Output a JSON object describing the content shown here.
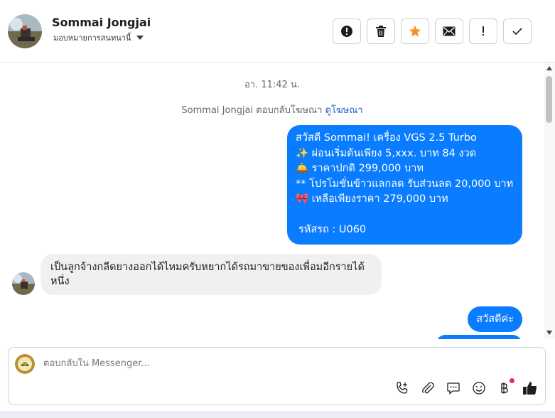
{
  "header": {
    "contact_name": "Sommai Jongjai",
    "assignee_label": "มอบหมายการสนทนานี้",
    "actions": [
      {
        "name": "mark-spam",
        "icon": "alert-circle-icon"
      },
      {
        "name": "delete",
        "icon": "trash-icon"
      },
      {
        "name": "star",
        "icon": "star-icon",
        "color": "#f7931e"
      },
      {
        "name": "mark-unread",
        "icon": "envelope-icon"
      },
      {
        "name": "follow-up",
        "icon": "exclamation-icon"
      },
      {
        "name": "mark-done",
        "icon": "checkmark-icon"
      }
    ]
  },
  "conversation": {
    "timestamp": "อา. 11:42 น.",
    "reply_note": {
      "text": "Sommai Jongjai ตอบกลับโฆษณา",
      "link": "ดูโฆษณา"
    },
    "outgoing_ad_message": {
      "lines": [
        "สวัสดี Sommai! เครื่อง VGS 2.5 Turbo",
        "✨  ผ่อนเริ่มต้นเพียง 5,xxx. บาท 84 งวด",
        "🛎️ ราคาปกติ 299,000 บาท",
        "** โปรโมชั่นข้าวแลกลด รับส่วนลด 20,000 บาท",
        "🎀  เหลือเพียงราคา 279,000 บาท"
      ],
      "code": "รหัสรถ : U060"
    },
    "incoming_message": "เป็นลูกจ้างกลีดยางออกได้ไหมครับหยากได้รถมาขายของเพื่อมอีกรายได้หนึ่ง",
    "outgoing_greeting": "สวัสดีค่ะ"
  },
  "composer": {
    "placeholder": "ตอบกลับใน Messenger...",
    "tools": [
      "phone-plus-icon",
      "paperclip-icon",
      "chat-bubble-icon",
      "smiley-icon",
      "baht-icon",
      "thumbs-up-icon"
    ]
  },
  "colors": {
    "accent": "#0a7cff",
    "link": "#1f5fc8",
    "star": "#f7931e",
    "notification": "#f02849"
  }
}
